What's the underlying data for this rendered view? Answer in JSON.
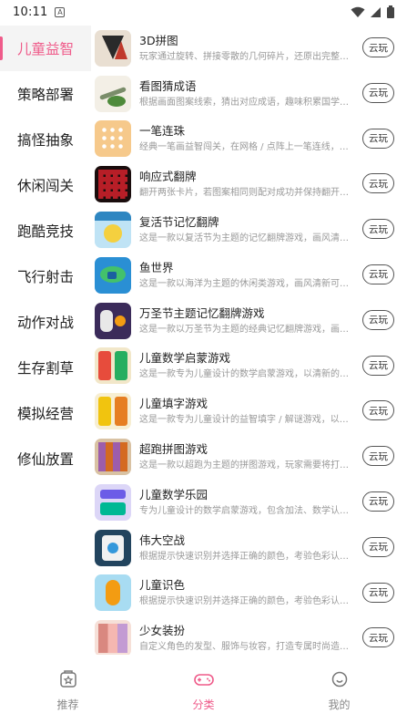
{
  "status_bar": {
    "time": "10:11",
    "notif_icon_letter": "A"
  },
  "sidebar": {
    "items": [
      {
        "label": "儿童益智",
        "active": true
      },
      {
        "label": "策略部署"
      },
      {
        "label": "搞怪抽象"
      },
      {
        "label": "休闲闯关"
      },
      {
        "label": "跑酷竞技"
      },
      {
        "label": "飞行射击"
      },
      {
        "label": "动作对战"
      },
      {
        "label": "生存割草"
      },
      {
        "label": "模拟经营"
      },
      {
        "label": "修仙放置"
      }
    ]
  },
  "games": [
    {
      "name": "3D拼图",
      "desc": "玩家通过旋转、拼接零散的几何碎片，还原出完整的 3...",
      "button": "云玩",
      "icon": "puzzle-3d-icon"
    },
    {
      "name": "看图猜成语",
      "desc": "根据画面图案线索，猜出对应成语，趣味积累国学知识",
      "button": "云玩",
      "icon": "idiom-guess-icon"
    },
    {
      "name": "一笔连珠",
      "desc": "经典一笔画益智闯关，在网格 / 点阵上一笔连线，不...",
      "button": "云玩",
      "icon": "one-stroke-icon"
    },
    {
      "name": "响应式翻牌",
      "desc": "翻开两张卡片，若图案相同则配对成功并保持翻开状...",
      "button": "云玩",
      "icon": "card-flip-icon"
    },
    {
      "name": "复活节记忆翻牌",
      "desc": "这是一款以复活节为主题的记忆翻牌游戏，画风清新...",
      "button": "云玩",
      "icon": "easter-memory-icon"
    },
    {
      "name": "鱼世界",
      "desc": "这是一款以海洋为主题的休闲类游戏，画风清新可爱...",
      "button": "云玩",
      "icon": "fish-world-icon"
    },
    {
      "name": "万圣节主题记忆翻牌游戏",
      "desc": "这是一款以万圣节为主题的经典记忆翻牌游戏，画面...",
      "button": "云玩",
      "icon": "halloween-memory-icon"
    },
    {
      "name": "儿童数学启蒙游戏",
      "desc": "这是一款专为儿童设计的数学启蒙游戏，以清新的田...",
      "button": "云玩",
      "icon": "kids-math-icon"
    },
    {
      "name": "儿童填字游戏",
      "desc": "这是一款专为儿童设计的益智填字 / 解谜游戏，以气...",
      "button": "云玩",
      "icon": "kids-crossword-icon"
    },
    {
      "name": "超跑拼图游戏",
      "desc": "这是一款以超跑为主题的拼图游戏，玩家需要将打乱...",
      "button": "云玩",
      "icon": "supercar-puzzle-icon"
    },
    {
      "name": "儿童数学乐园",
      "desc": "专为儿童设计的数学启蒙游戏，包含加法、数学认知...",
      "button": "云玩",
      "icon": "kids-math-park-icon"
    },
    {
      "name": "伟大空战",
      "desc": "根据提示快速识别并选择正确的颜色，考验色彩认知...",
      "button": "云玩",
      "icon": "air-battle-icon"
    },
    {
      "name": "儿童识色",
      "desc": "根据提示快速识别并选择正确的颜色，考验色彩认知...",
      "button": "云玩",
      "icon": "kids-color-icon"
    },
    {
      "name": "少女装扮",
      "desc": "自定义角色的发型、服饰与妆容，打造专属时尚造型...",
      "button": "云玩",
      "icon": "girl-dressup-icon"
    }
  ],
  "bottom_nav": {
    "tabs": [
      {
        "label": "推荐",
        "icon": "recommend-icon"
      },
      {
        "label": "分类",
        "icon": "gamepad-icon",
        "active": true
      },
      {
        "label": "我的",
        "icon": "profile-icon"
      }
    ]
  },
  "colors": {
    "accent": "#ef5b8a",
    "text": "#222222",
    "muted": "#999999"
  }
}
